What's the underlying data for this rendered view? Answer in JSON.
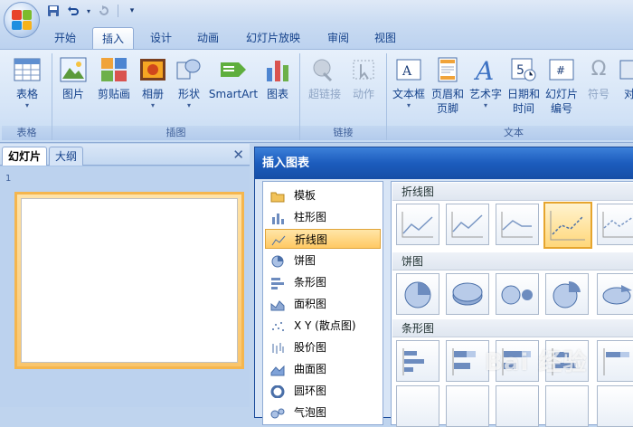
{
  "tabs": [
    "开始",
    "插入",
    "设计",
    "动画",
    "幻灯片放映",
    "审阅",
    "视图"
  ],
  "active_tab": "插入",
  "ribbon": {
    "groups": [
      {
        "label": "表格",
        "buttons": [
          {
            "label": "表格",
            "icon": "table-icon",
            "dropdown": true
          }
        ]
      },
      {
        "label": "插图",
        "buttons": [
          {
            "label": "图片",
            "icon": "picture-icon"
          },
          {
            "label": "剪贴画",
            "icon": "clipart-icon"
          },
          {
            "label": "相册",
            "icon": "photo-album-icon",
            "dropdown": true
          },
          {
            "label": "形状",
            "icon": "shapes-icon",
            "dropdown": true
          },
          {
            "label": "SmartArt",
            "icon": "smartart-icon"
          },
          {
            "label": "图表",
            "icon": "chart-icon"
          }
        ]
      },
      {
        "label": "链接",
        "buttons": [
          {
            "label": "超链接",
            "icon": "hyperlink-icon",
            "disabled": true
          },
          {
            "label": "动作",
            "icon": "action-icon",
            "disabled": true
          }
        ]
      },
      {
        "label": "文本",
        "buttons": [
          {
            "label": "文本框",
            "icon": "textbox-icon",
            "dropdown": true
          },
          {
            "label": "页眉和页脚",
            "icon": "header-footer-icon"
          },
          {
            "label": "艺术字",
            "icon": "wordart-icon",
            "dropdown": true
          },
          {
            "label": "日期和时间",
            "icon": "date-time-icon"
          },
          {
            "label": "幻灯片编号",
            "icon": "slide-number-icon"
          },
          {
            "label": "符号",
            "icon": "symbol-icon",
            "disabled": true
          },
          {
            "label": "对",
            "icon": "object-icon"
          }
        ]
      }
    ]
  },
  "left_pane": {
    "tabs": [
      "幻灯片",
      "大纲"
    ],
    "active_tab": "幻灯片",
    "slide_number": "1"
  },
  "dialog": {
    "title": "插入图表",
    "chart_types": [
      "模板",
      "柱形图",
      "折线图",
      "饼图",
      "条形图",
      "面积图",
      "X Y (散点图)",
      "股价图",
      "曲面图",
      "圆环图",
      "气泡图"
    ],
    "selected_type": "折线图",
    "sections": [
      "折线图",
      "饼图",
      "条形图"
    ]
  },
  "watermark": "Bai 经验",
  "colors": {
    "accent": "#15428b",
    "selection": "#ffc964",
    "dialog_title": "#1c5cbd"
  }
}
